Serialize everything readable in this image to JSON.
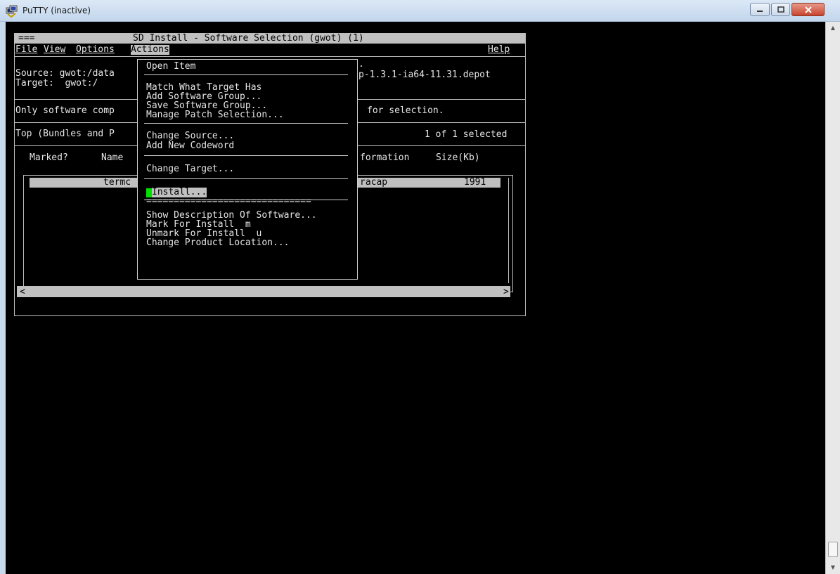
{
  "window": {
    "title": "PuTTY (inactive)",
    "icon": "putty-icon"
  },
  "sd": {
    "title_left": "===",
    "title": "SD Install - Software Selection (gwot) (1)",
    "menubar": {
      "file": "File",
      "view": "View",
      "options": "Options",
      "actions": "Actions",
      "help": "Help"
    },
    "source_label": "Source: gwot:/data",
    "source_suffix": "p-1.3.1-ia64-11.31.depot",
    "dot": ".",
    "target_label": "Target:  gwot:/",
    "only_software": "Only software comp",
    "for_selection": "for selection.",
    "top_bundles": "Top (Bundles and P",
    "selected_count": "1 of 1 selected",
    "columns": {
      "marked": "Marked?",
      "name": "Name",
      "information": "formation",
      "size": "Size(Kb)"
    },
    "row": {
      "name": "termc",
      "information": "racap",
      "size": "1991"
    },
    "scroll_left": "<",
    "scroll_right": ">"
  },
  "menu": {
    "items": [
      "Open Item",
      "Match What Target Has",
      "Add Software Group...",
      "Save Software Group...",
      "Manage Patch Selection...",
      "Change Source...",
      "Add New Codeword",
      "Change Target...",
      "Install...",
      "==============================",
      "Show Description Of Software...",
      "Mark For Install  m",
      "Unmark For Install  u",
      "Change Product Location..."
    ]
  }
}
